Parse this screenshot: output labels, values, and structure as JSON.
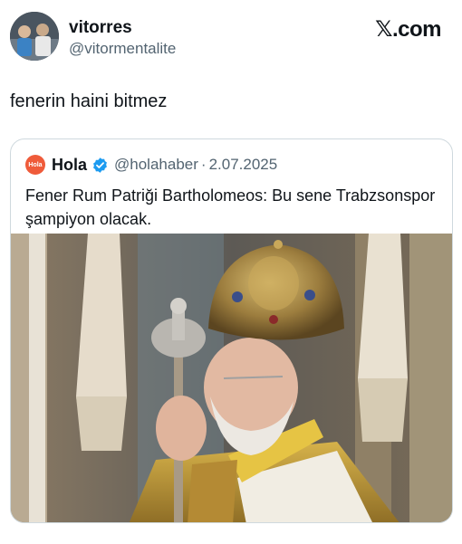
{
  "author": {
    "display_name": "vitorres",
    "handle": "@vitormentalite",
    "avatar_icon": "user-avatar"
  },
  "brand": "𝕏.com",
  "tweet": {
    "text": "fenerin haini bitmez"
  },
  "quoted": {
    "logo_text": "Hola",
    "display_name": "Hola",
    "verified_icon": "verified-badge-icon",
    "handle": "@holahaber",
    "separator": "·",
    "date": "2.07.2025",
    "text": "Fener Rum Patriği Bartholomeos: Bu sene Trabzsonspor şampiyon olacak.",
    "image_icon": "patriarch-photo"
  },
  "colors": {
    "text": "#0f1419",
    "muted": "#536471",
    "border": "#cfd9de",
    "verified": "#1d9bf0",
    "hola": "#ef5b3a"
  }
}
